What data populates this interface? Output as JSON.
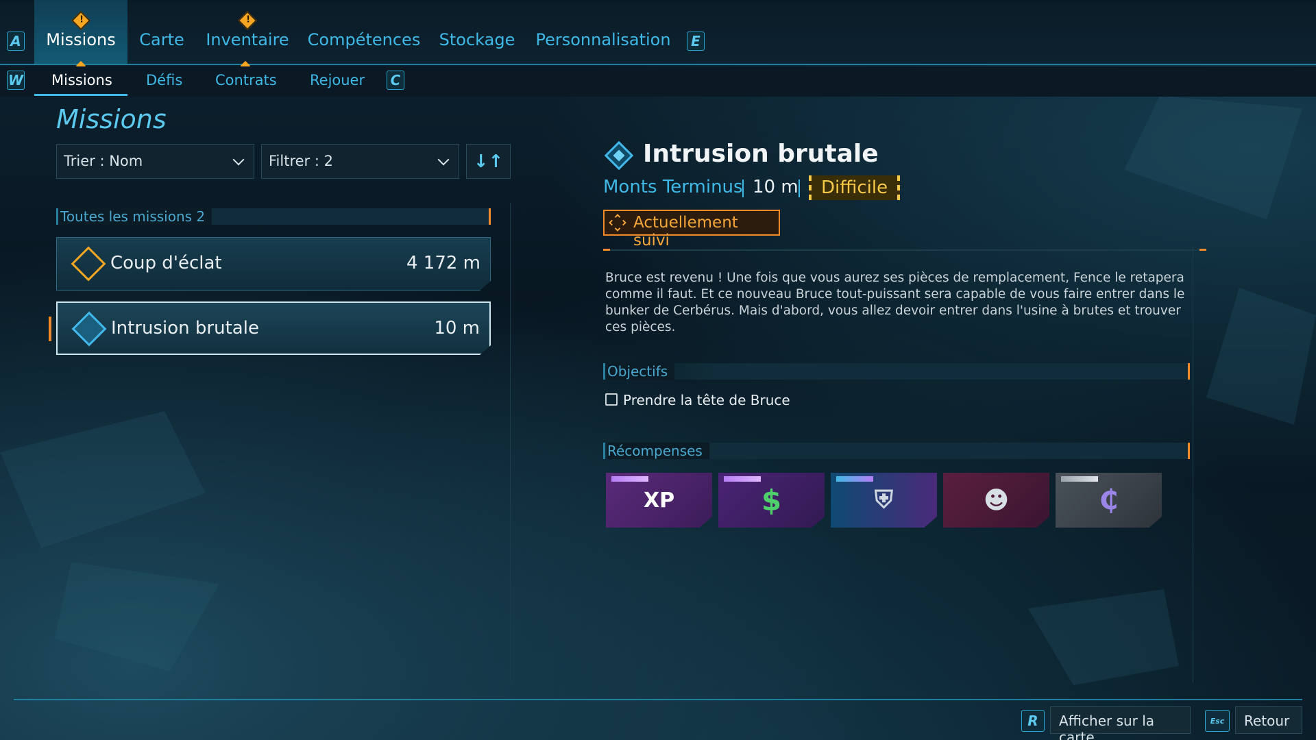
{
  "keys": {
    "top_left": "A",
    "top_right": "E",
    "sub_left": "W",
    "sub_right": "C",
    "map": "R",
    "esc": "Esc"
  },
  "topnav": [
    {
      "label": "Missions",
      "active": true
    },
    {
      "label": "Carte"
    },
    {
      "label": "Inventaire"
    },
    {
      "label": "Compétences"
    },
    {
      "label": "Stockage"
    },
    {
      "label": "Personnalisation"
    }
  ],
  "subnav": [
    {
      "label": "Missions",
      "active": true
    },
    {
      "label": "Défis"
    },
    {
      "label": "Contrats"
    },
    {
      "label": "Rejouer"
    }
  ],
  "page_title": "Missions",
  "sort_label": "Trier : Nom",
  "filter_label": "Filtrer : 2",
  "list_header": "Toutes les missions 2",
  "missions": [
    {
      "name": "Coup d'éclat",
      "distance": "4 172 m"
    },
    {
      "name": "Intrusion brutale",
      "distance": "10 m",
      "selected": true
    }
  ],
  "detail": {
    "title": "Intrusion brutale",
    "location": "Monts Terminus",
    "distance": "10 m",
    "difficulty": "Difficile",
    "tracked": "Actuellement suivi",
    "description": "Bruce est revenu ! Une fois que vous aurez ses pièces de remplacement, Fence le retapera comme il faut. Et ce nouveau Bruce tout-puissant sera capable de vous faire entrer dans le bunker de Cerbérus. Mais d'abord, vous allez devoir entrer dans l'usine à brutes et trouver ces pièces.",
    "objectives_header": "Objectifs",
    "objectives": [
      "Prendre la tête de Bruce"
    ],
    "rewards_header": "Récompenses",
    "rewards": [
      {
        "icon": "xp-icon",
        "text": "XP"
      },
      {
        "icon": "cash-icon",
        "text": "$"
      },
      {
        "icon": "shield-icon",
        "text": "⛨"
      },
      {
        "icon": "mask-icon",
        "text": "☻"
      },
      {
        "icon": "currency-icon",
        "text": "₵"
      }
    ]
  },
  "bottom": {
    "map_label": "Afficher sur la carte",
    "back_label": "Retour"
  },
  "colors": {
    "accent": "#3fb8e6",
    "orange": "#f08a2a",
    "difficulty": "#f7c948"
  }
}
